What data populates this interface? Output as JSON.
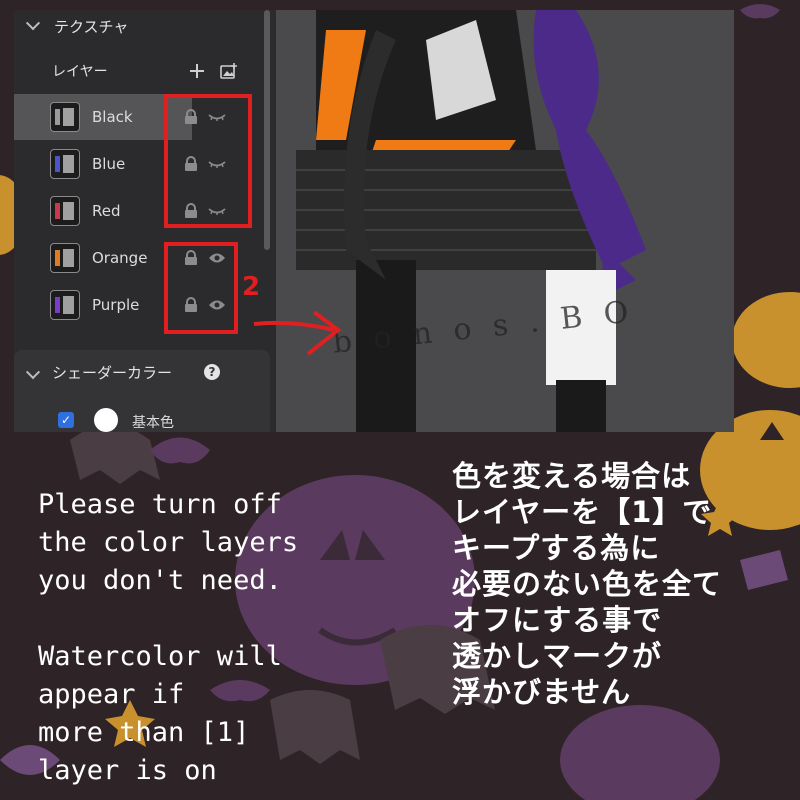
{
  "texture_section": {
    "title": "テクスチャ"
  },
  "layers": {
    "heading": "レイヤー",
    "items": [
      {
        "name": "Black",
        "visible": false,
        "selected": true,
        "thumb_color": "#9a9a9a"
      },
      {
        "name": "Blue",
        "visible": false,
        "selected": false,
        "thumb_color": "#4a56c8"
      },
      {
        "name": "Red",
        "visible": false,
        "selected": false,
        "thumb_color": "#c83a4a"
      },
      {
        "name": "Orange",
        "visible": true,
        "selected": false,
        "thumb_color": "#e07a24"
      },
      {
        "name": "Purple",
        "visible": true,
        "selected": false,
        "thumb_color": "#7a3cc8"
      }
    ]
  },
  "shader_section": {
    "title": "シェーダーカラー",
    "help": "?"
  },
  "base_color": {
    "label": "基本色",
    "checked": true
  },
  "annotation": {
    "number": "2"
  },
  "viewport": {
    "watermark": "b  o n o s . B O"
  },
  "captions": {
    "english": "Please turn off\nthe color layers\nyou don't need.\n\nWatercolor will\nappear if\nmore than [1]\nlayer is on",
    "japanese": "色を変える場合は\nレイヤーを【1】で\nキープする為に\n必要のない色を全て\nオフにする事で\n透かしマークが\n浮かびません"
  },
  "colors": {
    "background": "#2e2326",
    "highlight_red": "#e02020",
    "pumpkin_orange": "#c8912d",
    "pumpkin_purple": "#5a3a5e"
  }
}
